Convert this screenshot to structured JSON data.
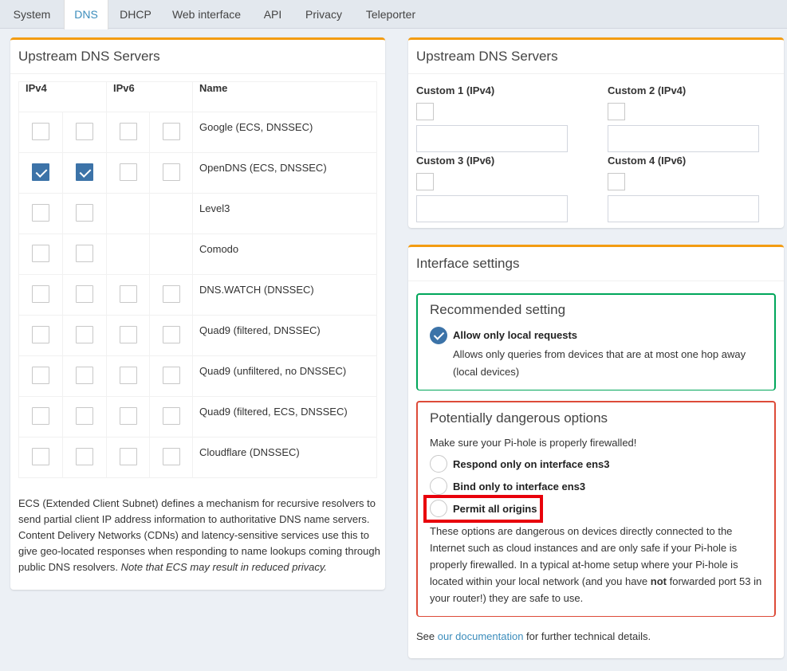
{
  "tabs": [
    "System",
    "DNS",
    "DHCP",
    "Web interface",
    "API",
    "Privacy",
    "Teleporter"
  ],
  "active_tab": "DNS",
  "upstream_left": {
    "title": "Upstream DNS Servers",
    "headers": {
      "ipv4": "IPv4",
      "ipv6": "IPv6",
      "name": "Name"
    },
    "rows": [
      {
        "name": "Google (ECS, DNSSEC)",
        "v4": [
          false,
          false
        ],
        "v6": [
          false,
          false
        ]
      },
      {
        "name": "OpenDNS (ECS, DNSSEC)",
        "v4": [
          true,
          true
        ],
        "v6": [
          false,
          false
        ]
      },
      {
        "name": "Level3",
        "v4": [
          false,
          false
        ],
        "v6": null
      },
      {
        "name": "Comodo",
        "v4": [
          false,
          false
        ],
        "v6": null
      },
      {
        "name": "DNS.WATCH (DNSSEC)",
        "v4": [
          false,
          false
        ],
        "v6": [
          false,
          false
        ]
      },
      {
        "name": "Quad9 (filtered, DNSSEC)",
        "v4": [
          false,
          false
        ],
        "v6": [
          false,
          false
        ]
      },
      {
        "name": "Quad9 (unfiltered, no DNSSEC)",
        "v4": [
          false,
          false
        ],
        "v6": [
          false,
          false
        ]
      },
      {
        "name": "Quad9 (filtered, ECS, DNSSEC)",
        "v4": [
          false,
          false
        ],
        "v6": [
          false,
          false
        ]
      },
      {
        "name": "Cloudflare (DNSSEC)",
        "v4": [
          false,
          false
        ],
        "v6": [
          false,
          false
        ]
      }
    ],
    "ecs_text": "ECS (Extended Client Subnet) defines a mechanism for recursive resolvers to send partial client IP address information to authoritative DNS name servers. Content Delivery Networks (CDNs) and latency-sensitive services use this to give geo-located responses when responding to name lookups coming through public DNS resolvers. ",
    "ecs_note": "Note that ECS may result in reduced privacy."
  },
  "upstream_custom": {
    "title": "Upstream DNS Servers",
    "custom1": "Custom 1 (IPv4)",
    "custom2": "Custom 2 (IPv4)",
    "custom3": "Custom 3 (IPv6)",
    "custom4": "Custom 4 (IPv6)"
  },
  "interface": {
    "title": "Interface settings",
    "recommended": {
      "title": "Recommended setting",
      "option": "Allow only local requests",
      "desc": "Allows only queries from devices that are at most one hop away (local devices)"
    },
    "dangerous": {
      "title": "Potentially dangerous options",
      "warning": "Make sure your Pi-hole is properly firewalled!",
      "opt1": "Respond only on interface ens3",
      "opt2": "Bind only to interface ens3",
      "opt3": "Permit all origins",
      "desc_a": "These options are dangerous on devices directly connected to the Internet such as cloud instances and are only safe if your Pi-hole is properly firewalled. In a typical at-home setup where your Pi-hole is located within your local network (and you have ",
      "desc_bold": "not",
      "desc_b": " forwarded port 53 in your router!) they are safe to use."
    },
    "footer_pre": "See ",
    "footer_link": "our documentation",
    "footer_post": " for further technical details."
  },
  "colors": {
    "accent": "#f39c12",
    "link": "#3c8dbc",
    "checked": "#3c73a8",
    "green": "#00a65a",
    "red": "#dd4b39",
    "highlight": "#e8000b"
  }
}
